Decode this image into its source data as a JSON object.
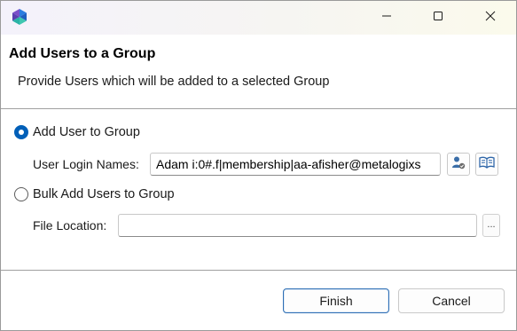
{
  "titlebar": {
    "app_icon": "app-logo-icon",
    "minimize_icon": "minimize-icon",
    "maximize_icon": "maximize-icon",
    "close_icon": "close-icon"
  },
  "header": {
    "title": "Add Users to a Group",
    "subtitle": "Provide Users which will be added to a selected Group"
  },
  "options": {
    "add_user": {
      "label": "Add User to Group",
      "selected": true,
      "login_label": "User Login Names:",
      "login_value": "Adam i:0#.f|membership|aa-afisher@metalogixs",
      "check_names_icon": "check-user-icon",
      "browse_icon": "address-book-icon"
    },
    "bulk_add": {
      "label": "Bulk Add Users to Group",
      "selected": false,
      "file_label": "File Location:",
      "file_value": "",
      "browse_label": "..."
    }
  },
  "footer": {
    "finish_label": "Finish",
    "cancel_label": "Cancel"
  },
  "colors": {
    "accent": "#005fb8",
    "app_icon_blue": "#2b7de0",
    "app_icon_purple": "#7b4fc9",
    "app_icon_teal": "#2ab3a6"
  }
}
